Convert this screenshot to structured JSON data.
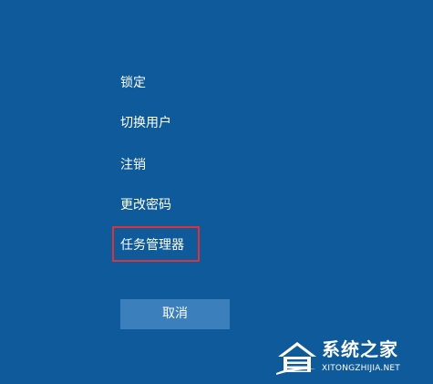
{
  "power_menu": {
    "items": [
      {
        "label": "锁定"
      },
      {
        "label": "切换用户"
      },
      {
        "label": "注销"
      },
      {
        "label": "更改密码"
      },
      {
        "label": "任务管理器",
        "highlighted": true
      }
    ],
    "cancel_label": "取消"
  },
  "colors": {
    "background": "#0e5a9a",
    "button": "#3c7fbd",
    "highlight_border": "#d9343a",
    "text": "#ffffff"
  },
  "watermark": {
    "title": "系统之家",
    "url": "XITONGZHIJIA.NET",
    "logo_icon": "house-logo-icon"
  }
}
